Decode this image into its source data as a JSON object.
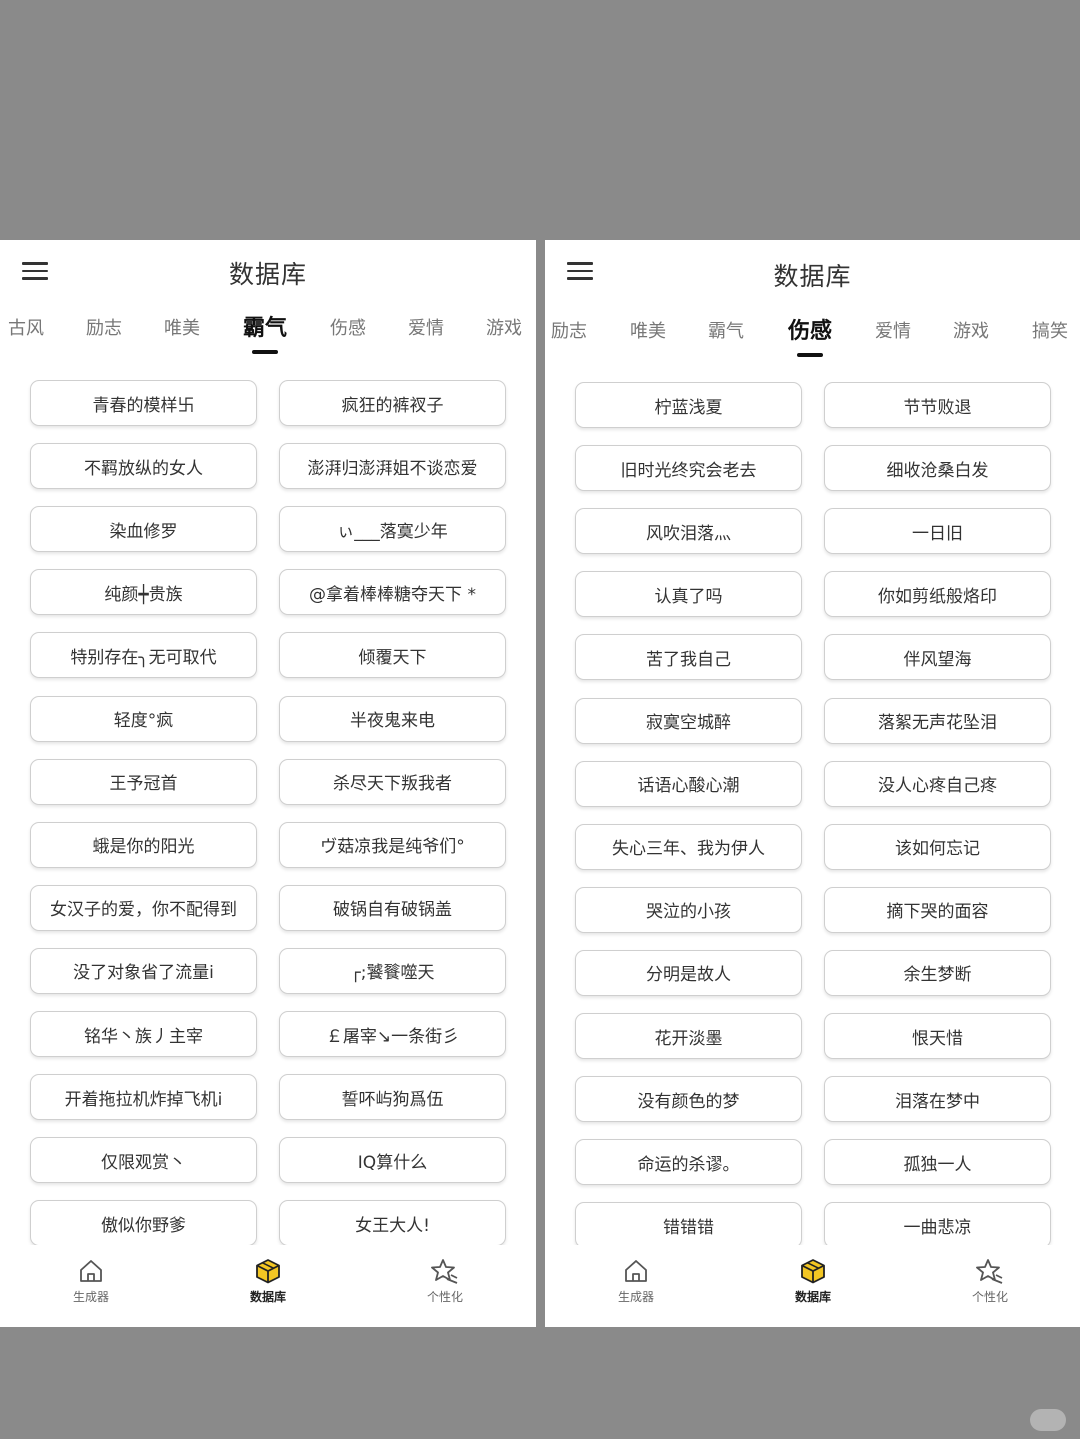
{
  "left": {
    "title": "数据库",
    "tabs": [
      "古风",
      "励志",
      "唯美",
      "霸气",
      "伤感",
      "爱情",
      "游戏"
    ],
    "active_tab": "霸气",
    "items": [
      "青春的模样卐",
      "疯狂的裤衩子",
      "不羁放纵的女人",
      "澎湃归澎湃姐不谈恋爱",
      "染血修罗",
      "ぃ___落寞少年",
      "纯颜┿贵族",
      "@拿着棒棒糖夺天下 *",
      "特别存在╮无可取代",
      "倾覆天下",
      "轻度°疯",
      "半夜鬼来电",
      "王予冠首",
      "杀尽天下叛我者",
      "蛾是你的阳光",
      "ヴ菇凉我是纯爷们°",
      "女汉子的爱，你不配得到",
      "破锅自有破锅盖",
      "没了对象省了流量i",
      "┌;饕餮噬天",
      "铭华丶族丿主宰",
      "￡屠宰↘一条街彡",
      "开着拖拉机炸掉飞机i",
      "誓吥屿狗爲伍",
      "仅限观赏丶",
      "IQ算什么",
      "傲似你野爹",
      "女王大人!"
    ]
  },
  "right": {
    "title": "数据库",
    "tabs": [
      "励志",
      "唯美",
      "霸气",
      "伤感",
      "爱情",
      "游戏",
      "搞笑"
    ],
    "active_tab": "伤感",
    "items": [
      "柠蓝浅夏",
      "节节败退",
      "旧时光终究会老去",
      "细收沧桑白发",
      "风吹泪落灬",
      "一日旧",
      "认真了吗",
      "你如剪纸般烙印",
      "苦了我自己",
      "伴风望海",
      "寂寞空城醉",
      "落絮无声花坠泪",
      "话语心酸心潮",
      "没人心疼自己疼",
      "失心三年、我为伊人",
      "该如何忘记",
      "哭泣的小孩",
      "摘下哭的面容",
      "分明是故人",
      "余生梦断",
      "花开淡墨",
      "恨天惜",
      "没有颜色的梦",
      "泪落在梦中",
      "命运的杀谬。",
      "孤独一人",
      "错错错",
      "一曲悲凉"
    ]
  },
  "nav": {
    "items": [
      {
        "label": "生成器",
        "icon": "home-icon"
      },
      {
        "label": "数据库",
        "icon": "database-cube-icon"
      },
      {
        "label": "个性化",
        "icon": "personalize-star-icon"
      }
    ],
    "active": "数据库"
  },
  "colors": {
    "background": "#8a8a8a",
    "panel": "#ffffff",
    "accent": "#f3c623",
    "active_text": "#111111",
    "inactive_text": "#777777",
    "card_border": "#cfcfcf"
  }
}
